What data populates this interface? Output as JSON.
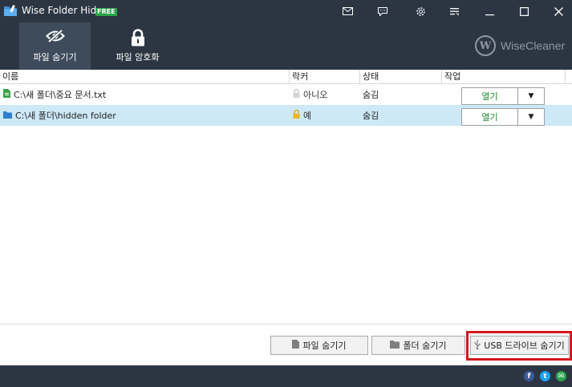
{
  "window": {
    "title": "Wise Folder Hider",
    "badge": "FREE"
  },
  "titlebar_buttons": [
    {
      "name": "mail-icon"
    },
    {
      "name": "feedback-icon"
    },
    {
      "name": "settings-icon"
    },
    {
      "name": "menu-icon"
    },
    {
      "name": "minimize-icon"
    },
    {
      "name": "maximize-icon"
    },
    {
      "name": "close-icon"
    }
  ],
  "tabs": [
    {
      "label": "파일 숨기기",
      "icon": "hidden-eye-icon",
      "active": true
    },
    {
      "label": "파일 암호화",
      "icon": "lock-icon",
      "active": false
    }
  ],
  "brand": {
    "logo_letter": "W",
    "name": "WiseCleaner"
  },
  "columns": {
    "name": "이름",
    "locker": "락커",
    "status": "상태",
    "action": "작업"
  },
  "rows": [
    {
      "type": "file",
      "icon": "file-icon",
      "path": "C:\\새 폴더\\중요 문서.txt",
      "locked": false,
      "locker_text": "아니오",
      "status": "숨김",
      "action_label": "열기",
      "dropdown": "▼",
      "selected": false
    },
    {
      "type": "folder",
      "icon": "folder-icon",
      "path": "C:\\새 폴더\\hidden folder",
      "locked": true,
      "locker_text": "예",
      "status": "숨김",
      "action_label": "열기",
      "dropdown": "▼",
      "selected": true
    }
  ],
  "bottom_buttons": {
    "hide_file": "파일 숨기기",
    "hide_folder": "폴더 숨기기",
    "hide_usb": "USB 드라이브 숨기기"
  },
  "colors": {
    "chrome": "#2c3643",
    "active_tab": "#3d4b5b",
    "selected_row": "#cde8f6",
    "open_action": "#1e8a2e",
    "highlight": "#d6161f"
  },
  "social": [
    {
      "name": "facebook-icon",
      "glyph": "f",
      "color": "#3b5998"
    },
    {
      "name": "twitter-icon",
      "glyph": "t",
      "color": "#1da1f2"
    },
    {
      "name": "message-icon",
      "glyph": "✉",
      "color": "#2ea44f"
    }
  ]
}
